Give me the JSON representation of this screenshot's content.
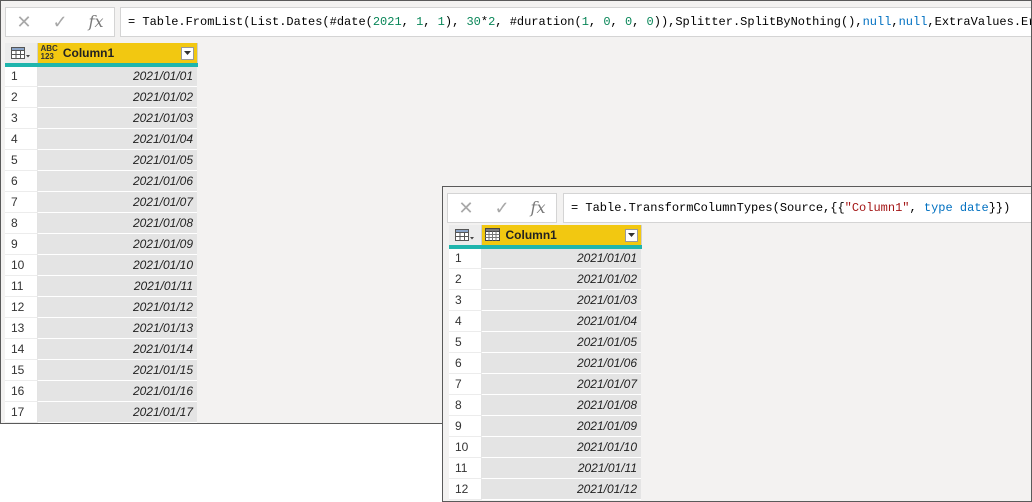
{
  "formula_bar_1": {
    "cancel_glyph": "✕",
    "commit_glyph": "✓",
    "fx_label": "fx",
    "tokens": [
      {
        "text": "= Table.FromList(List.Dates(#date(",
        "kind": "plain"
      },
      {
        "text": "2021",
        "kind": "num"
      },
      {
        "text": ", ",
        "kind": "plain"
      },
      {
        "text": "1",
        "kind": "num"
      },
      {
        "text": ", ",
        "kind": "plain"
      },
      {
        "text": "1",
        "kind": "num"
      },
      {
        "text": "), ",
        "kind": "plain"
      },
      {
        "text": "30",
        "kind": "num"
      },
      {
        "text": "*",
        "kind": "plain"
      },
      {
        "text": "2",
        "kind": "num"
      },
      {
        "text": ", #duration(",
        "kind": "plain"
      },
      {
        "text": "1",
        "kind": "num"
      },
      {
        "text": ", ",
        "kind": "plain"
      },
      {
        "text": "0",
        "kind": "num"
      },
      {
        "text": ", ",
        "kind": "plain"
      },
      {
        "text": "0",
        "kind": "num"
      },
      {
        "text": ", ",
        "kind": "plain"
      },
      {
        "text": "0",
        "kind": "num"
      },
      {
        "text": ")),Splitter.SplitByNothing(),",
        "kind": "plain"
      },
      {
        "text": "null",
        "kind": "kw"
      },
      {
        "text": ",",
        "kind": "plain"
      },
      {
        "text": "null",
        "kind": "kw"
      },
      {
        "text": ",ExtraValues.Error)",
        "kind": "plain"
      }
    ]
  },
  "table_1": {
    "column_header": "Column1",
    "type_icon_line1": "ABC",
    "type_icon_line2": "123",
    "rows": [
      {
        "num": "1",
        "value": "2021/01/01"
      },
      {
        "num": "2",
        "value": "2021/01/02"
      },
      {
        "num": "3",
        "value": "2021/01/03"
      },
      {
        "num": "4",
        "value": "2021/01/04"
      },
      {
        "num": "5",
        "value": "2021/01/05"
      },
      {
        "num": "6",
        "value": "2021/01/06"
      },
      {
        "num": "7",
        "value": "2021/01/07"
      },
      {
        "num": "8",
        "value": "2021/01/08"
      },
      {
        "num": "9",
        "value": "2021/01/09"
      },
      {
        "num": "10",
        "value": "2021/01/10"
      },
      {
        "num": "11",
        "value": "2021/01/11"
      },
      {
        "num": "12",
        "value": "2021/01/12"
      },
      {
        "num": "13",
        "value": "2021/01/13"
      },
      {
        "num": "14",
        "value": "2021/01/14"
      },
      {
        "num": "15",
        "value": "2021/01/15"
      },
      {
        "num": "16",
        "value": "2021/01/16"
      },
      {
        "num": "17",
        "value": "2021/01/17"
      }
    ]
  },
  "formula_bar_2": {
    "cancel_glyph": "✕",
    "commit_glyph": "✓",
    "fx_label": "fx",
    "tokens": [
      {
        "text": "= Table.TransformColumnTypes(Source,{{",
        "kind": "plain"
      },
      {
        "text": "\"Column1\"",
        "kind": "str"
      },
      {
        "text": ", ",
        "kind": "plain"
      },
      {
        "text": "type",
        "kind": "kw"
      },
      {
        "text": " ",
        "kind": "plain"
      },
      {
        "text": "date",
        "kind": "kw"
      },
      {
        "text": "}})",
        "kind": "plain"
      }
    ]
  },
  "table_2": {
    "column_header": "Column1",
    "rows": [
      {
        "num": "1",
        "value": "2021/01/01"
      },
      {
        "num": "2",
        "value": "2021/01/02"
      },
      {
        "num": "3",
        "value": "2021/01/03"
      },
      {
        "num": "4",
        "value": "2021/01/04"
      },
      {
        "num": "5",
        "value": "2021/01/05"
      },
      {
        "num": "6",
        "value": "2021/01/06"
      },
      {
        "num": "7",
        "value": "2021/01/07"
      },
      {
        "num": "8",
        "value": "2021/01/08"
      },
      {
        "num": "9",
        "value": "2021/01/09"
      },
      {
        "num": "10",
        "value": "2021/01/10"
      },
      {
        "num": "11",
        "value": "2021/01/11"
      },
      {
        "num": "12",
        "value": "2021/01/12"
      }
    ]
  },
  "colors": {
    "header_highlight": "#f2c811",
    "header_underline": "#1fb5ad",
    "cell_bg": "#e4e4e4",
    "number_token": "#098658",
    "string_token": "#a31515",
    "keyword_token": "#0070c1"
  }
}
